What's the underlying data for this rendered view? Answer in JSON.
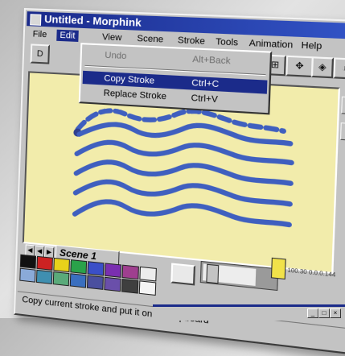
{
  "window": {
    "title": "Untitled - Morphink"
  },
  "menubar": {
    "items": [
      "File",
      "Edit",
      "View",
      "Scene",
      "Stroke",
      "Tools",
      "Animation",
      "Help"
    ]
  },
  "edit_menu": {
    "items": [
      {
        "label": "Undo",
        "shortcut": "Alt+Back"
      },
      {
        "label": "Copy Stroke",
        "shortcut": "Ctrl+C"
      },
      {
        "label": "Replace Stroke",
        "shortcut": "Ctrl+V"
      }
    ]
  },
  "scene_tab": {
    "label": "Scene 1"
  },
  "status_bar": {
    "text": "Copy current stroke and put it on the clipboard"
  },
  "counter": {
    "text": "100.30  0.0.0.144"
  },
  "colors": {
    "canvas_bg": "#f2ecab",
    "stroke": "#3f5fbf",
    "title_bar": "#1a2a8a",
    "menu_highlight": "#1b2b8a"
  },
  "palette": [
    "#111111",
    "#cc2222",
    "#e8d21a",
    "#2aa24a",
    "#3a4fc8",
    "#7a2fb0",
    "#9f3f8f",
    "#ececec",
    "#8aaad8",
    "#3f8fb0",
    "#5aaa7a",
    "#3a6fbf",
    "#4a4f9f",
    "#6a4faa",
    "#3f3f3f",
    "#f4f4f4"
  ],
  "icons": [
    "toolbar-text-icon",
    "copy-icon",
    "paste-icon",
    "select-icon",
    "grid-icon",
    "zoom-icon",
    "morph-icon",
    "end-icon",
    "scroll-up-icon",
    "scroll-down-icon",
    "color-picker-icon",
    "slider-thumb-icon",
    "frame-indicator-icon"
  ]
}
